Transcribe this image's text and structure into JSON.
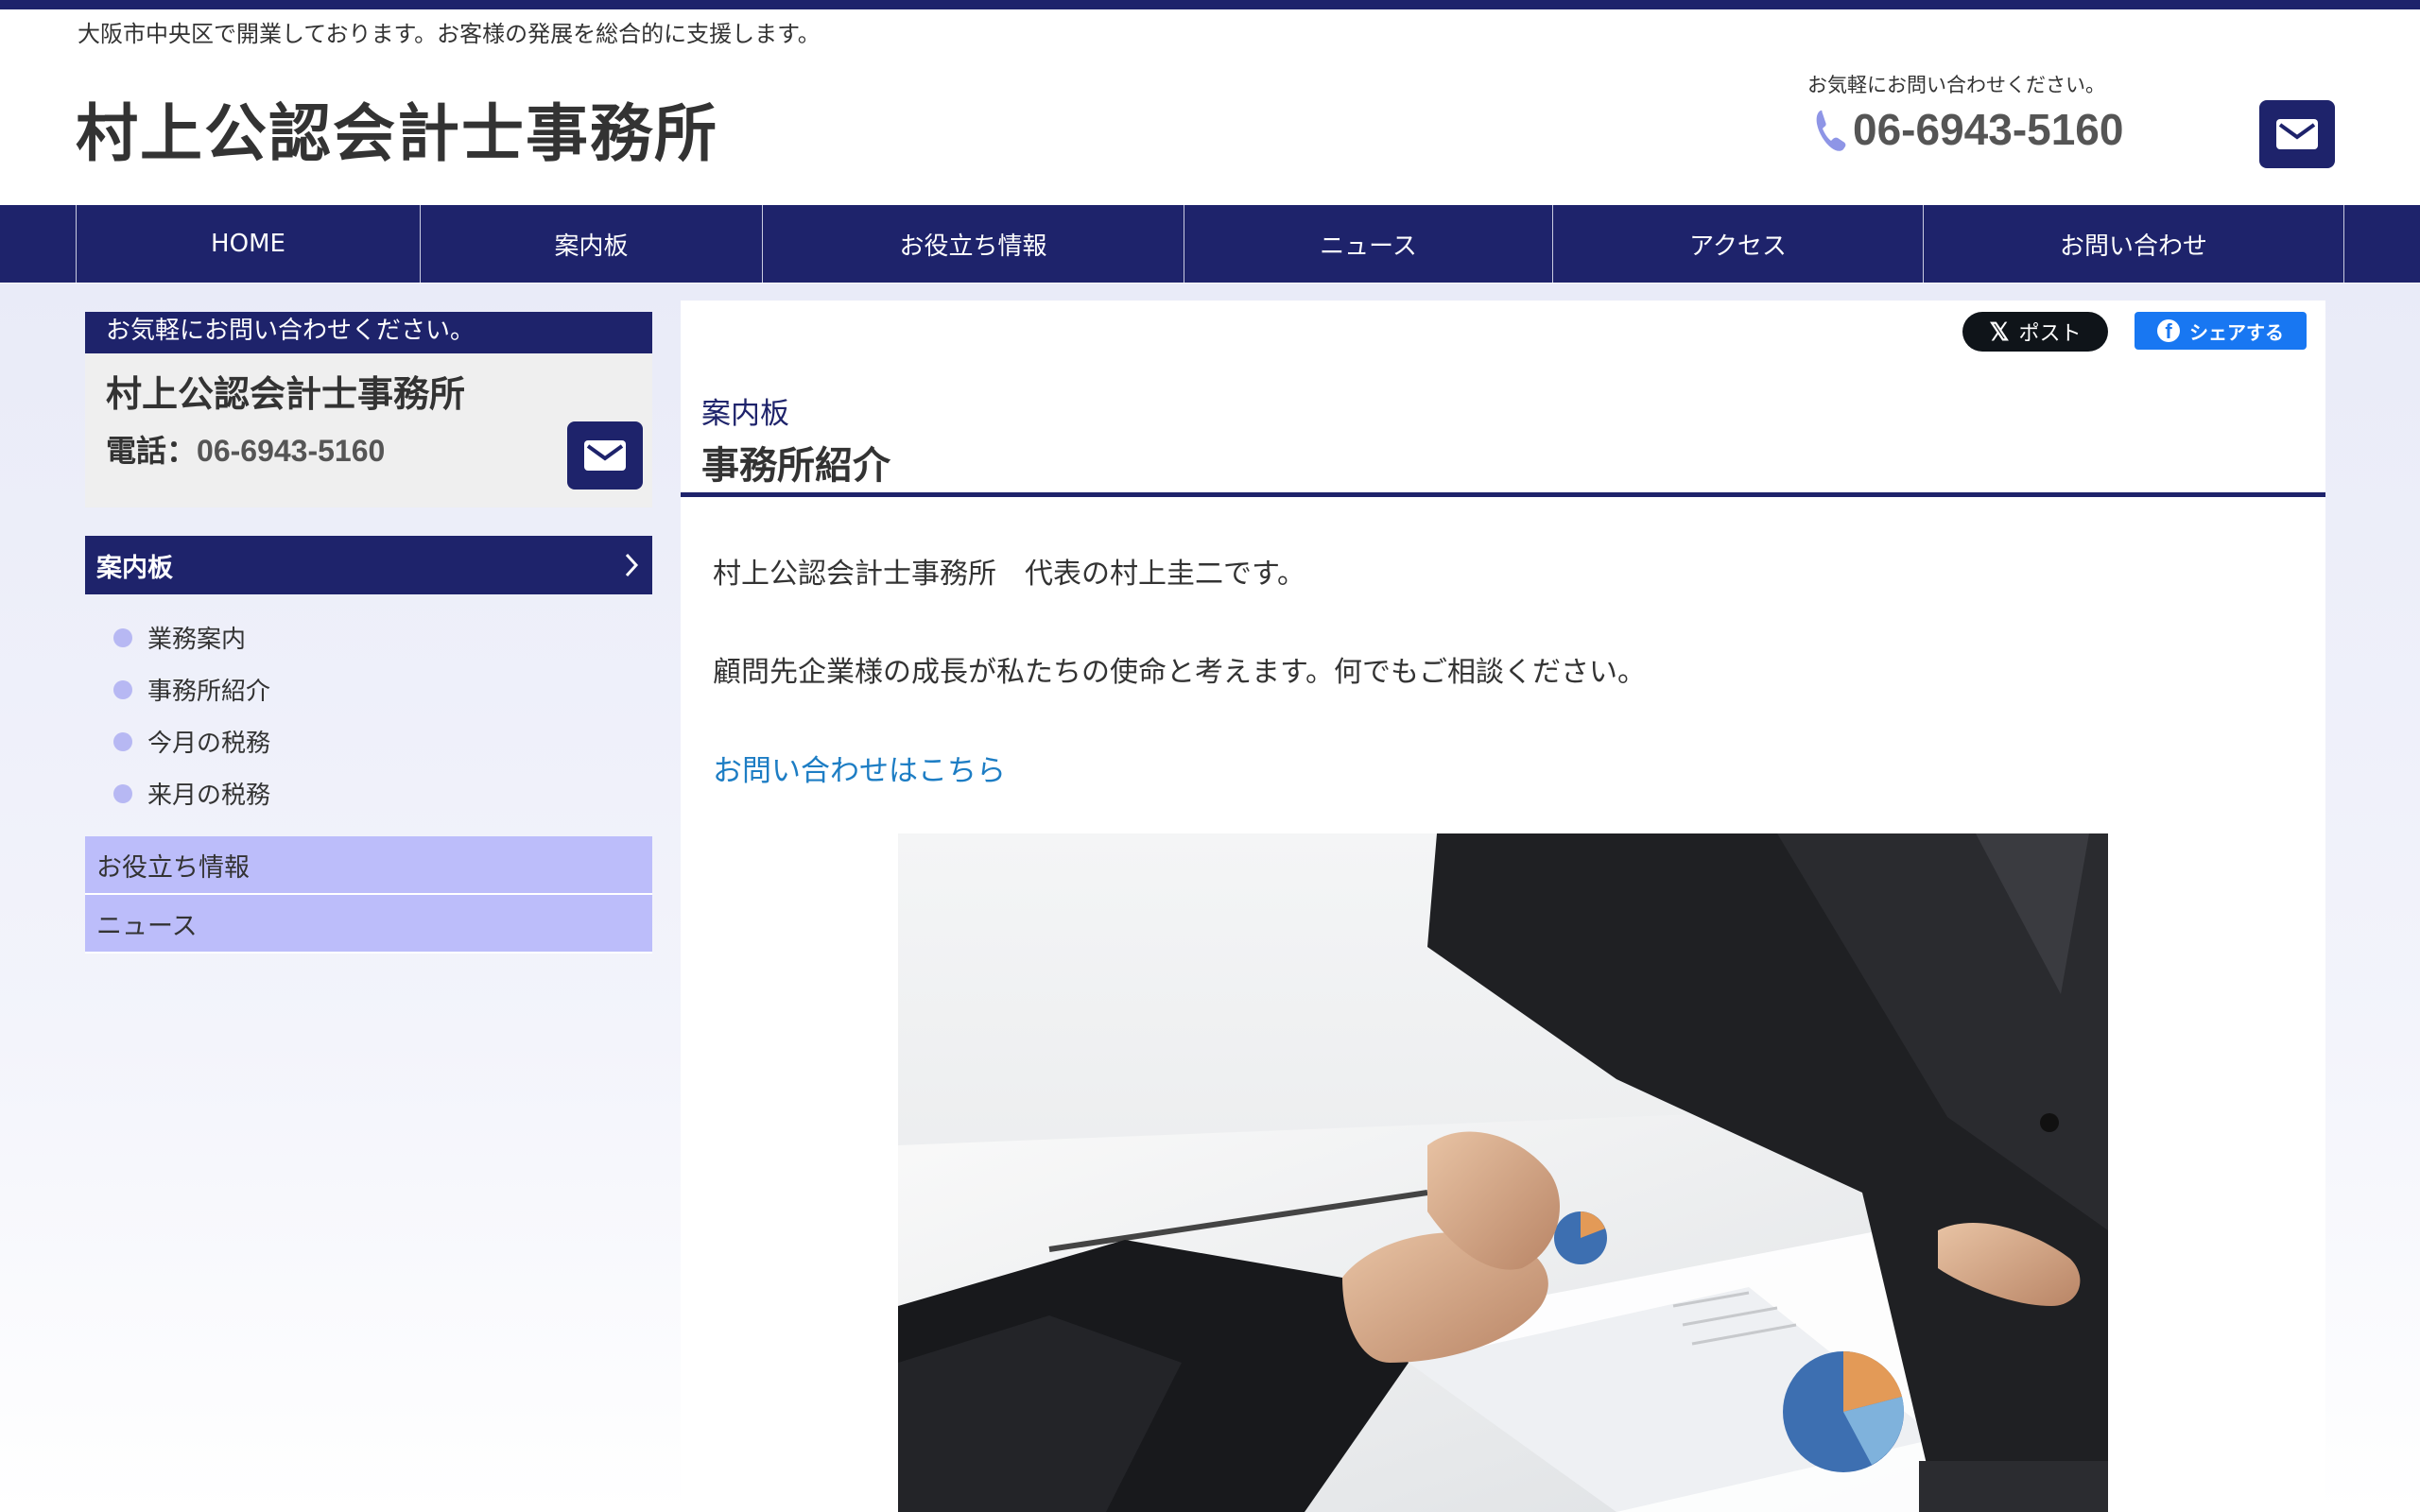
{
  "header": {
    "tagline": "大阪市中央区で開業しております。お客様の発展を総合的に支援します。",
    "site_title": "村上公認会計士事務所",
    "contact_note": "お気軽にお問い合わせください。",
    "phone": "06-6943-5160"
  },
  "nav": {
    "items": [
      {
        "label": "HOME"
      },
      {
        "label": "案内板"
      },
      {
        "label": "お役立ち情報"
      },
      {
        "label": "ニュース"
      },
      {
        "label": "アクセス"
      },
      {
        "label": "お問い合わせ"
      }
    ]
  },
  "sidebar": {
    "contact_head": "お気軽にお問い合わせください。",
    "office_name": "村上公認会計士事務所",
    "phone_label": "電話：",
    "phone": "06-6943-5160",
    "menu_head": "案内板",
    "menu_items": [
      {
        "label": "業務案内"
      },
      {
        "label": "事務所紹介"
      },
      {
        "label": "今月の税務"
      },
      {
        "label": "来月の税務"
      }
    ],
    "categories": [
      {
        "label": "お役立ち情報"
      },
      {
        "label": "ニュース"
      }
    ]
  },
  "main": {
    "x_post_label": "ポスト",
    "fb_share_label": "シェアする",
    "breadcrumb": "案内板",
    "title": "事務所紹介",
    "para1": "村上公認会計士事務所　代表の村上圭二です。",
    "para2": "顧問先企業様の成長が私たちの使命と考えます。何でもご相談ください。",
    "contact_link": "お問い合わせはこちら"
  },
  "colors": {
    "brand_navy": "#1e236b",
    "lavender": "#bcbdfa",
    "link_blue": "#1d7dc4",
    "fb_blue": "#1877f2"
  },
  "icons": [
    "phone-icon",
    "mail-icon",
    "chevron-right-icon",
    "bullet-dot-icon",
    "x-logo-icon",
    "facebook-icon"
  ]
}
